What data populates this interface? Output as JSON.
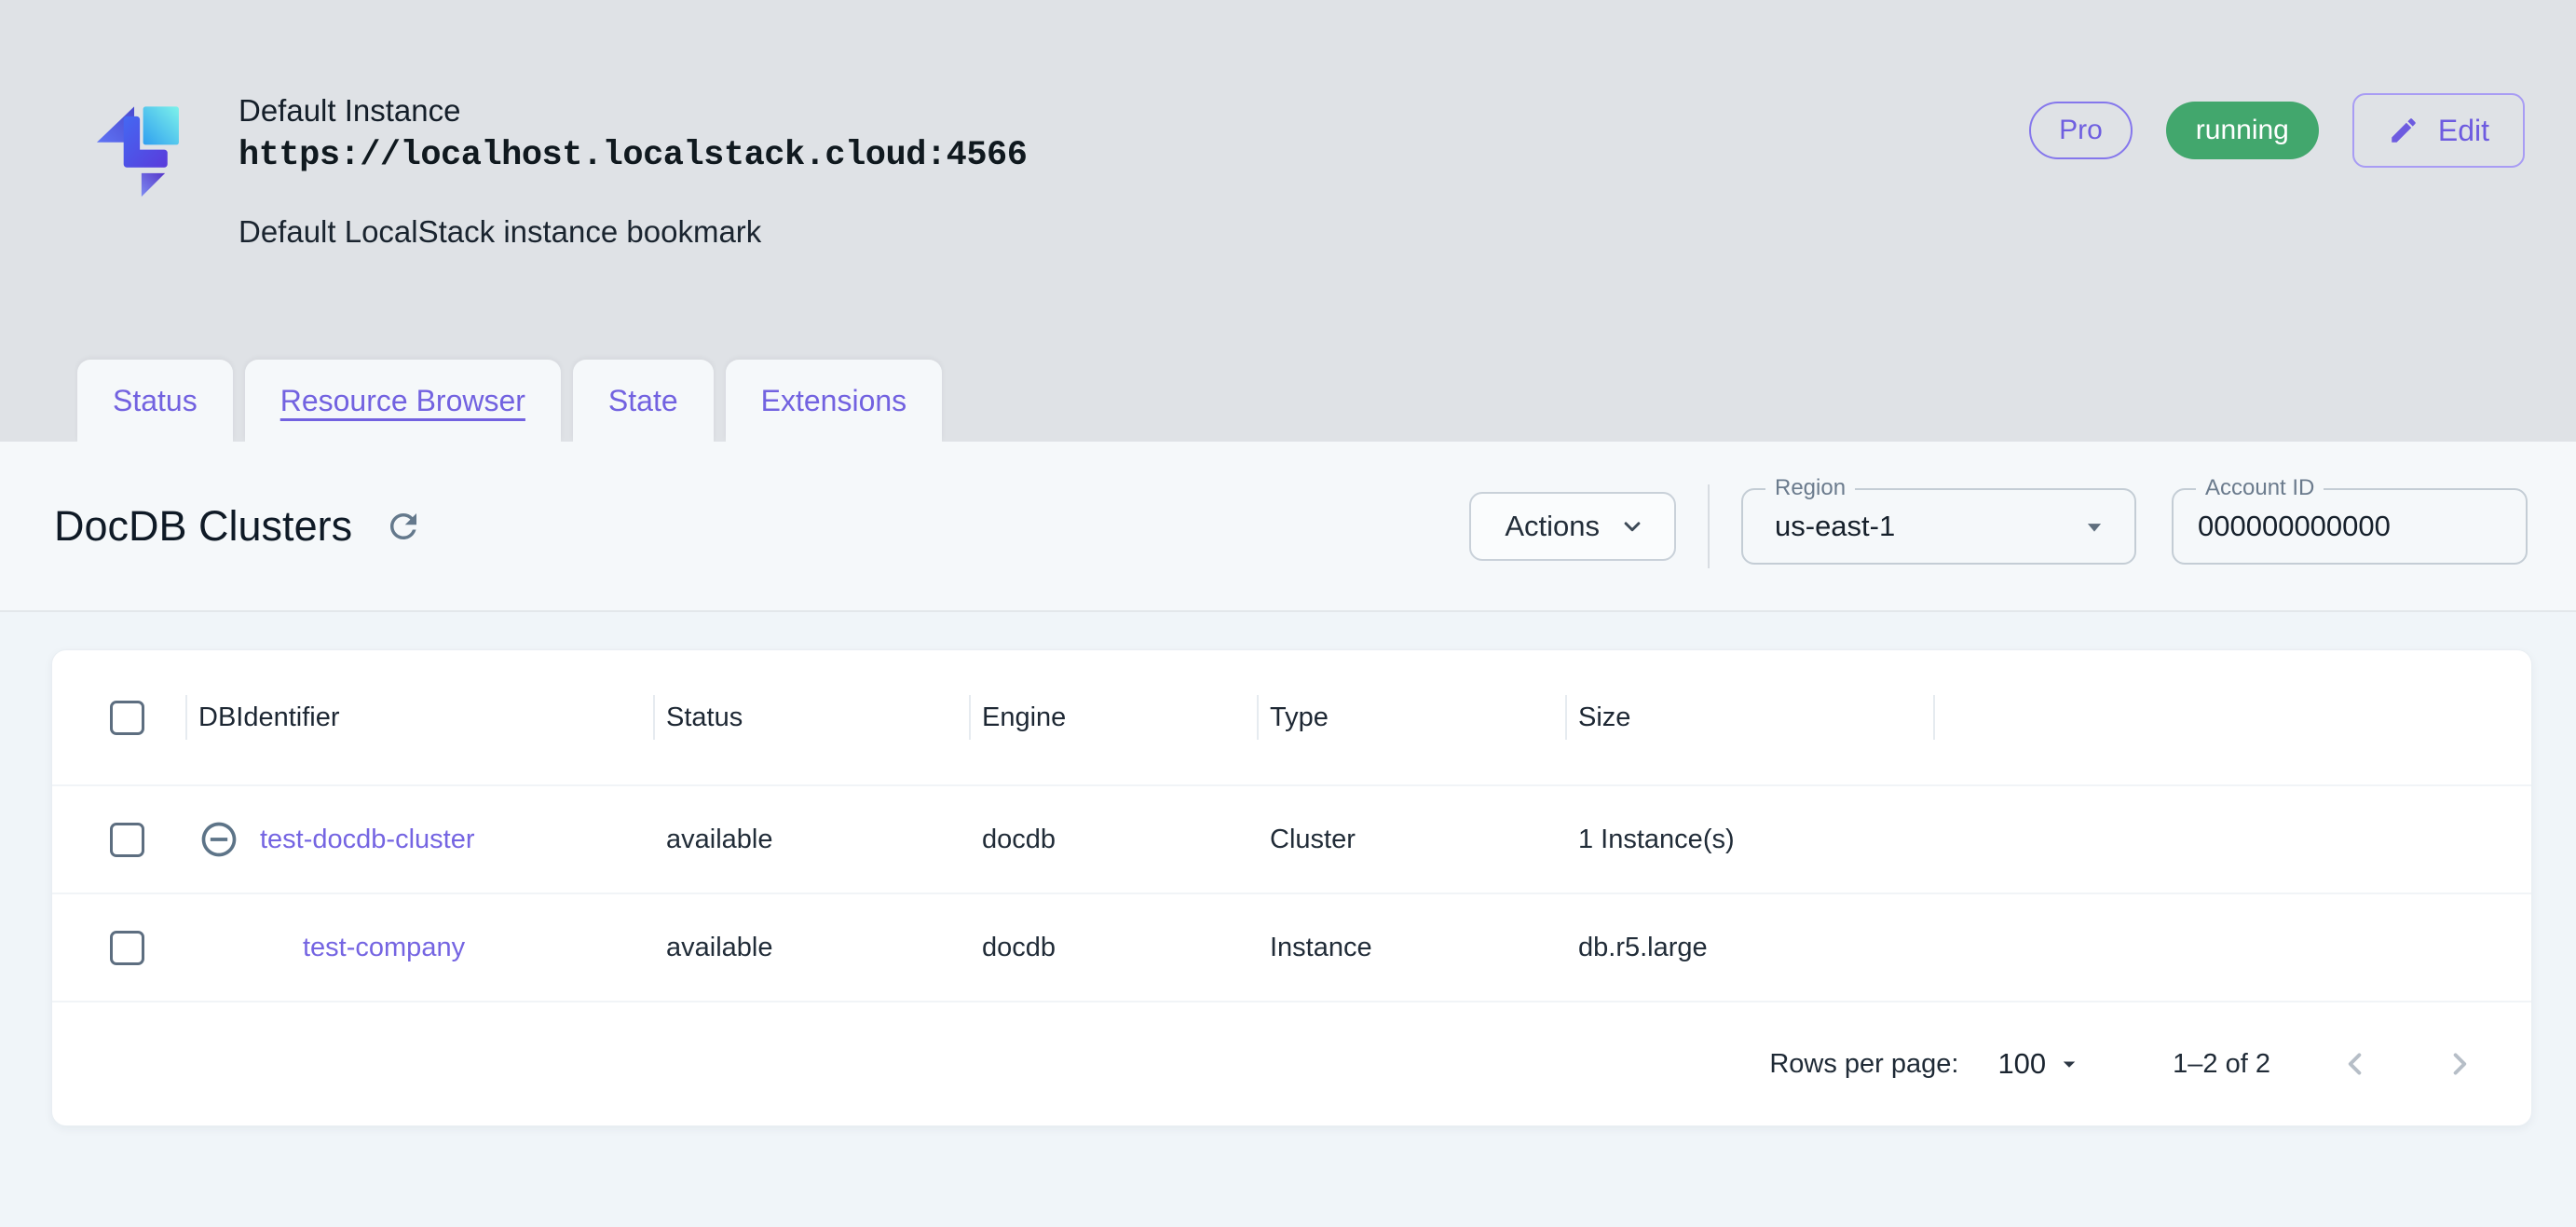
{
  "header": {
    "title": "Default Instance",
    "url": "https://localhost.localstack.cloud:4566",
    "subtitle": "Default LocalStack instance bookmark",
    "pro_badge": "Pro",
    "status_badge": "running",
    "edit_label": "Edit"
  },
  "tabs": [
    {
      "label": "Status",
      "active": false
    },
    {
      "label": "Resource Browser",
      "active": true
    },
    {
      "label": "State",
      "active": false
    },
    {
      "label": "Extensions",
      "active": false
    }
  ],
  "toolbar": {
    "page_title": "DocDB Clusters",
    "actions_label": "Actions",
    "region": {
      "label": "Region",
      "value": "us-east-1"
    },
    "account": {
      "label": "Account ID",
      "value": "000000000000"
    }
  },
  "table": {
    "columns": [
      "DBIdentifier",
      "Status",
      "Engine",
      "Type",
      "Size"
    ],
    "rows": [
      {
        "id": "test-docdb-cluster",
        "status": "available",
        "engine": "docdb",
        "type": "Cluster",
        "size": "1 Instance(s)",
        "expandable": true
      },
      {
        "id": "test-company",
        "status": "available",
        "engine": "docdb",
        "type": "Instance",
        "size": "db.r5.large",
        "expandable": false
      }
    ],
    "pagination": {
      "rows_per_page_label": "Rows per page:",
      "rows_per_page": "100",
      "range": "1–2 of 2"
    }
  },
  "icons": {
    "logo": "localstack-logo",
    "edit": "pencil-icon",
    "refresh": "refresh-icon"
  },
  "colors": {
    "accent_purple": "#7262e0",
    "status_green": "#42a76d",
    "header_bg": "#dfe2e6",
    "toolbar_bg": "#f5f8fa",
    "main_bg": "#f0f5f9",
    "icon_slate": "#5d7488"
  }
}
